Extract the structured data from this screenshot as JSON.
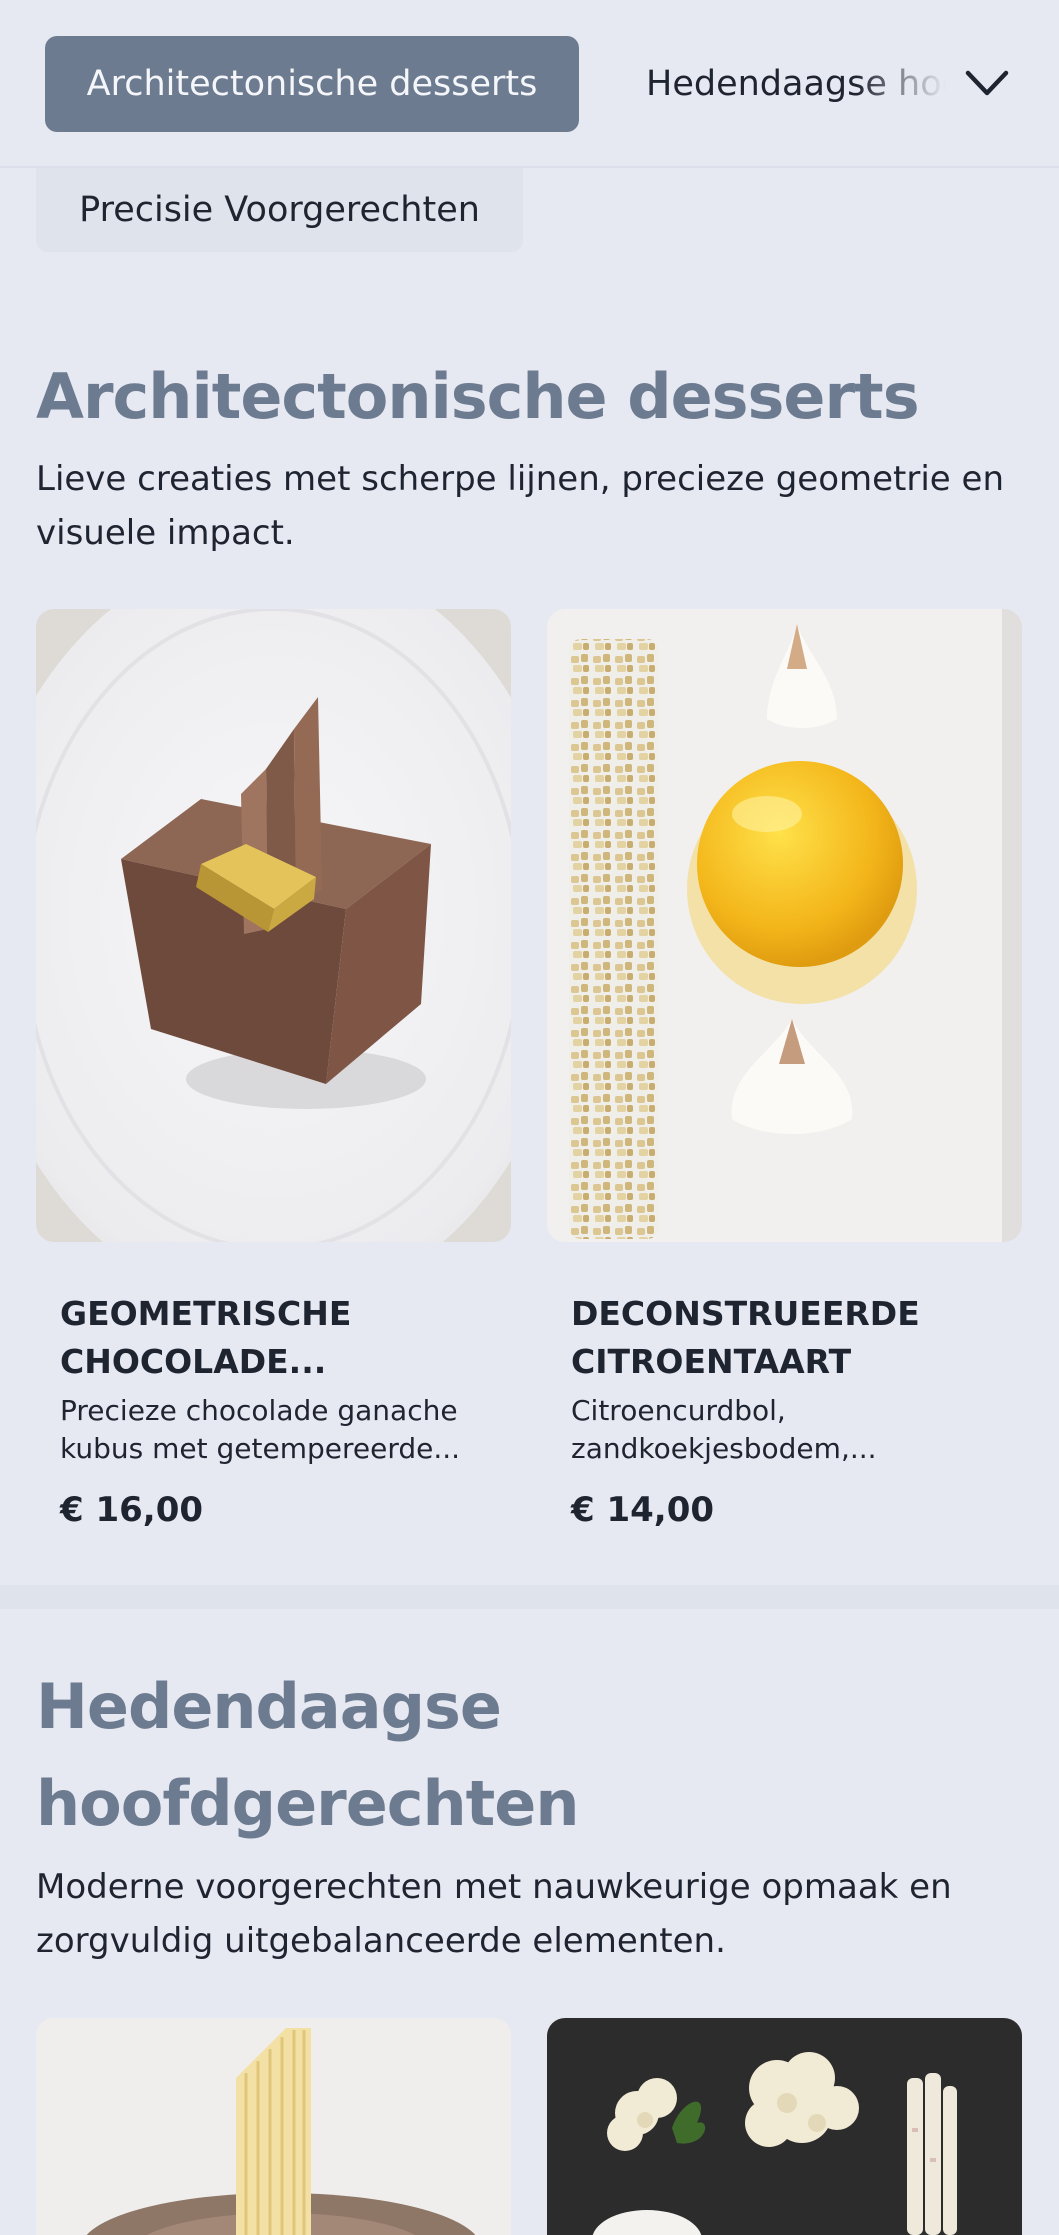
{
  "category_bar": {
    "active": "Architectonische desserts",
    "next": "Hedendaagse hoofdgerechten",
    "row2": "Precisie Voorgerechten"
  },
  "icons": {
    "expand": "chevron-down-icon"
  },
  "sections": [
    {
      "title": "Architectonische desserts",
      "description": "Lieve creaties met scherpe lijnen, precieze geometrie en visuele impact.",
      "items": [
        {
          "name": "Geometrische chocolade...",
          "description": "Precieze chocolade ganache kubus met getempereerde...",
          "price": "€ 16,00"
        },
        {
          "name": "Deconstrueerde citroentaart",
          "description": "Citroencurdbol, zandkoekjesbodem,...",
          "price": "€ 14,00"
        }
      ]
    },
    {
      "title_line1": "Hedendaagse",
      "title_line2": "hoofdgerechten",
      "description": "Moderne voorgerechten met nauwkeurige opmaak en zorgvuldig uitgebalanceerde elementen."
    }
  ],
  "colors": {
    "background": "#e7e9f2",
    "accent": "#6d7b90",
    "text": "#1f2431"
  }
}
